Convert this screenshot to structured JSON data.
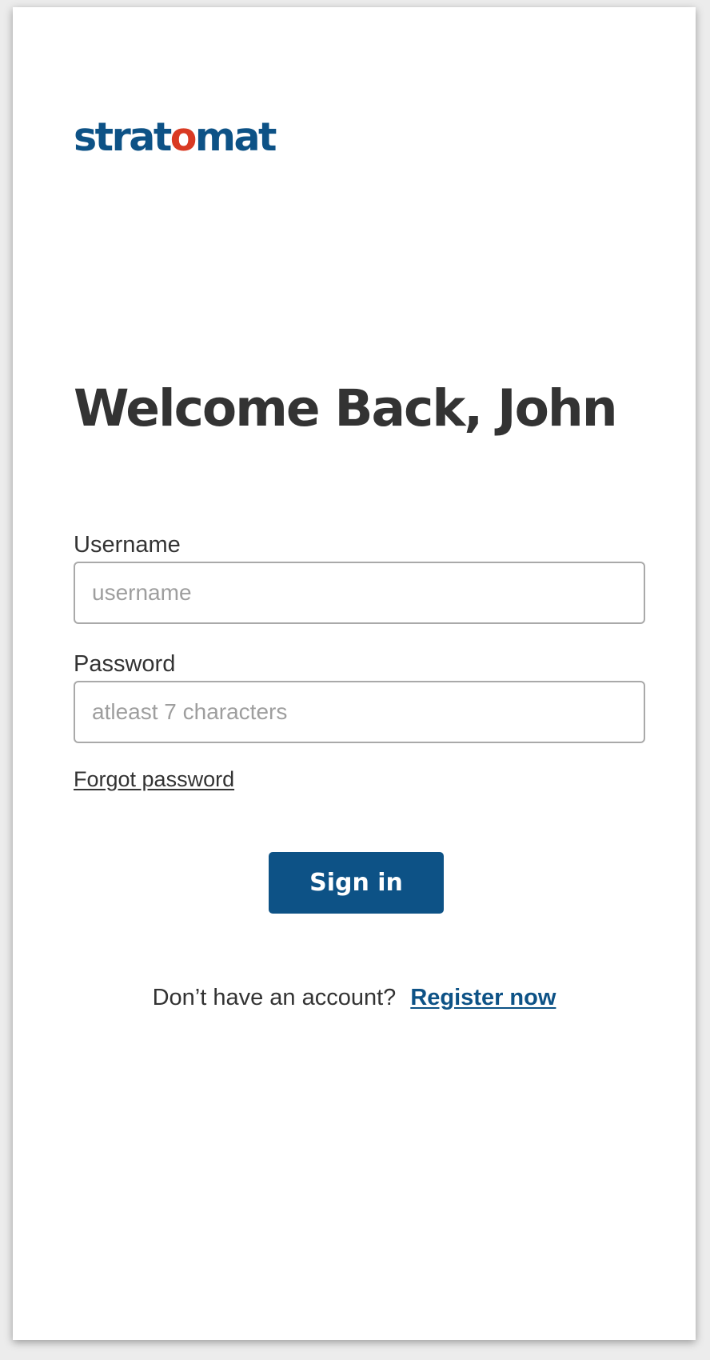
{
  "brand": {
    "logo_before": "strat",
    "logo_o": "o",
    "logo_after": "mat",
    "primary_color": "#0d5286",
    "accent_color": "#d93a23"
  },
  "page": {
    "title": "Welcome Back, John"
  },
  "form": {
    "username": {
      "label": "Username",
      "placeholder": "username",
      "value": ""
    },
    "password": {
      "label": "Password",
      "placeholder": "atleast 7 characters",
      "value": ""
    },
    "forgot_password": "Forgot password",
    "submit_label": "Sign in"
  },
  "register": {
    "prompt": "Don’t have an account?",
    "link": "Register now"
  }
}
